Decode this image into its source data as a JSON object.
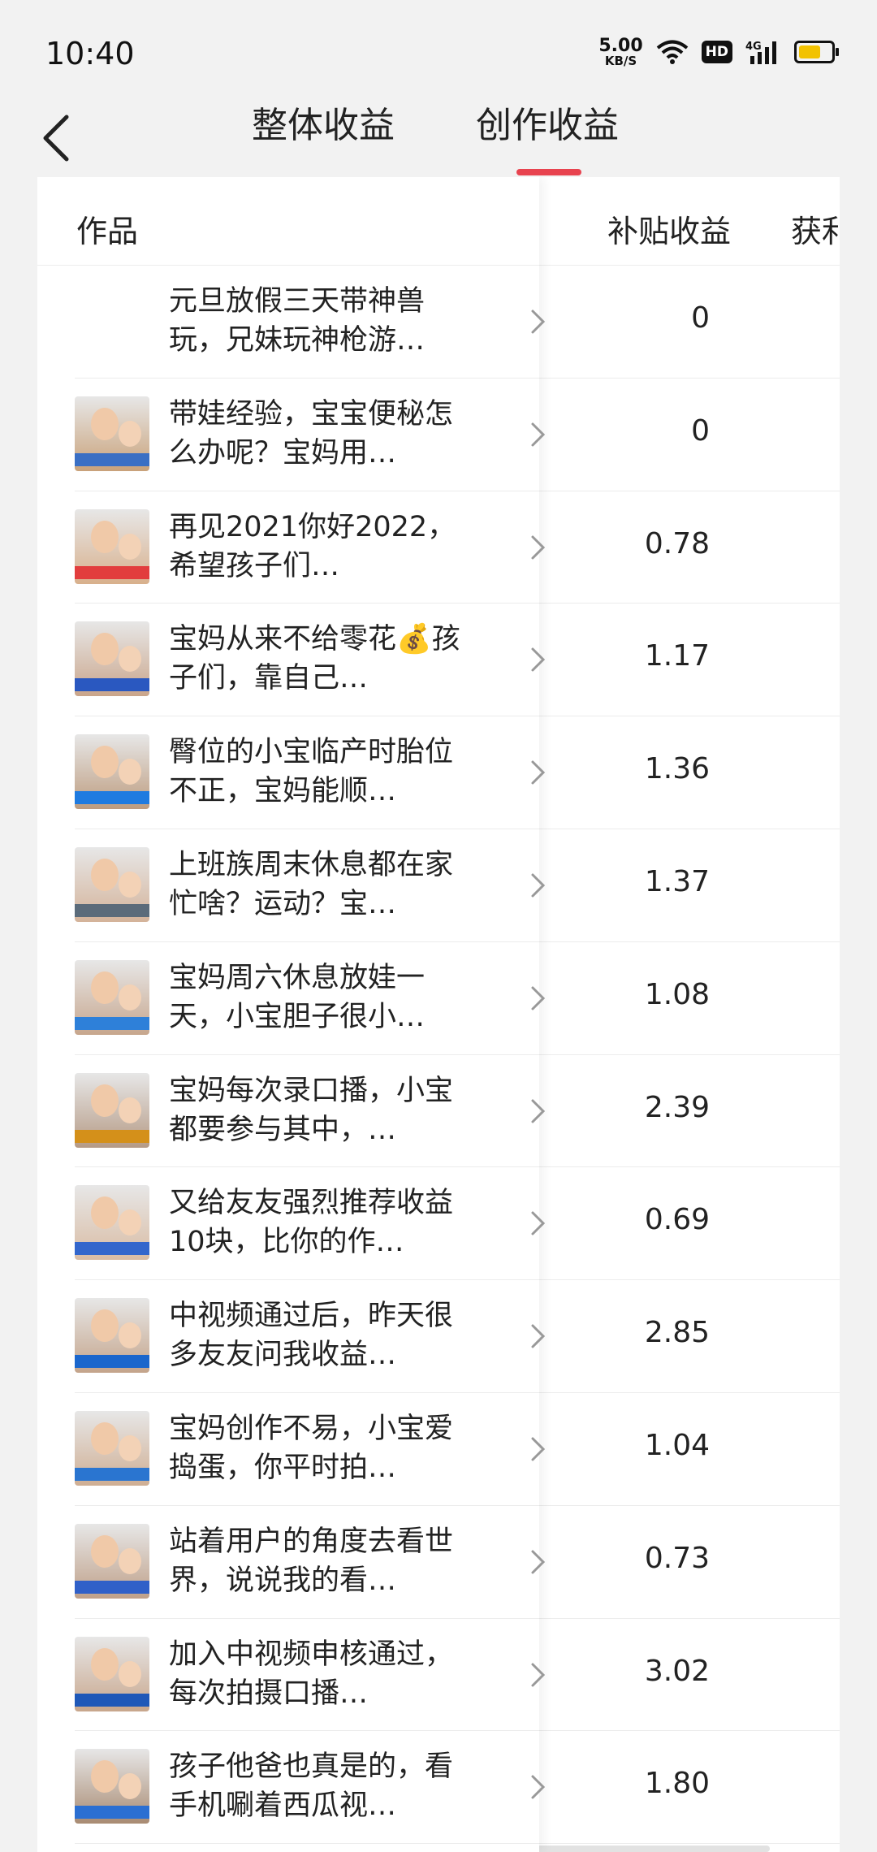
{
  "status": {
    "time": "10:40",
    "speed_value": "5.00",
    "speed_unit": "KB/S",
    "hd": "HD",
    "network": "4G"
  },
  "tabs": [
    {
      "label": "整体收益"
    },
    {
      "label": "创作收益"
    }
  ],
  "table": {
    "headers": {
      "work": "作品",
      "subsidy": "补贴收益",
      "profit": "获利播"
    },
    "rows": [
      {
        "title": "元旦放假三天带神兽玩，兄妹玩神枪游…",
        "subsidy": "0",
        "has_thumb": false
      },
      {
        "title": "带娃经验，宝宝便秘怎么办呢？宝妈用…",
        "subsidy": "0",
        "has_thumb": true
      },
      {
        "title": "再见2021你好2022，希望孩子们…",
        "subsidy": "0.78",
        "has_thumb": true
      },
      {
        "title": "宝妈从来不给零花💰孩子们，靠自己…",
        "subsidy": "1.17",
        "has_thumb": true
      },
      {
        "title": "臀位的小宝临产时胎位不正，宝妈能顺…",
        "subsidy": "1.36",
        "has_thumb": true
      },
      {
        "title": "上班族周末休息都在家忙啥？运动？宝…",
        "subsidy": "1.37",
        "has_thumb": true
      },
      {
        "title": "宝妈周六休息放娃一天，小宝胆子很小…",
        "subsidy": "1.08",
        "has_thumb": true
      },
      {
        "title": "宝妈每次录口播，小宝都要参与其中，…",
        "subsidy": "2.39",
        "has_thumb": true
      },
      {
        "title": "又给友友强烈推荐收益10块，比你的作…",
        "subsidy": "0.69",
        "has_thumb": true
      },
      {
        "title": "中视频通过后，昨天很多友友问我收益…",
        "subsidy": "2.85",
        "has_thumb": true
      },
      {
        "title": "宝妈创作不易，小宝爱捣蛋，你平时拍…",
        "subsidy": "1.04",
        "has_thumb": true
      },
      {
        "title": "站着用户的角度去看世界，说说我的看…",
        "subsidy": "0.73",
        "has_thumb": true
      },
      {
        "title": "加入中视频申核通过，每次拍摄口播…",
        "subsidy": "3.02",
        "has_thumb": true
      },
      {
        "title": "孩子他爸也真是的，看手机唰着西瓜视…",
        "subsidy": "1.80",
        "has_thumb": true
      }
    ]
  },
  "colors": {
    "accent": "#e8434f",
    "background": "#f2f2f2",
    "card": "#ffffff"
  }
}
